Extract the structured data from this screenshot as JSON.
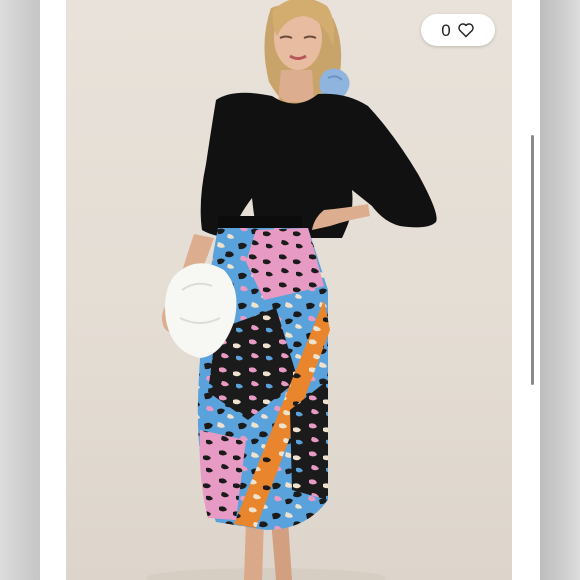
{
  "listing": {
    "like_count": "0"
  },
  "icons": {
    "like": "heart-outline-icon"
  },
  "colors": {
    "backdrop": "#e6e0d8",
    "top": "#111111",
    "skirt_blue": "#5aa2dc",
    "skirt_pink": "#e79bc4",
    "skirt_orange": "#e9852c",
    "skirt_black": "#1b1b1b",
    "skirt_cream": "#efe3cf"
  }
}
